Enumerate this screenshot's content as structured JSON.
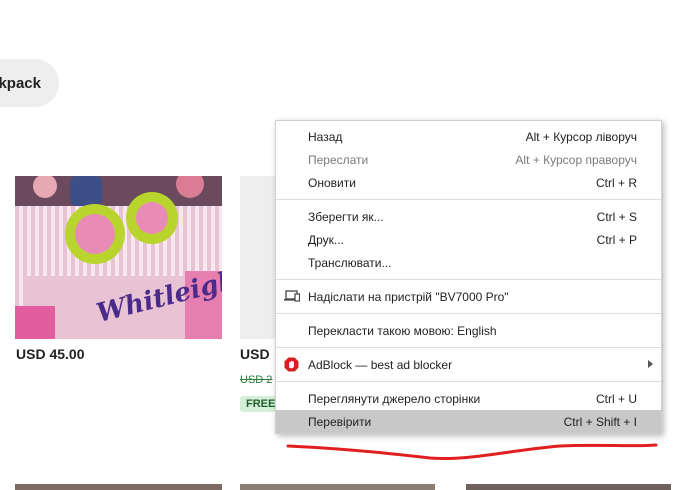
{
  "filter_chip": {
    "label": "kpack"
  },
  "products": [
    {
      "price": "USD 45.00",
      "embroidered_name": "Whitleigh"
    },
    {
      "price": "USD",
      "old_price": "USD 2",
      "badge": "FREE"
    }
  ],
  "context_menu": {
    "groups": [
      [
        {
          "label": "Назад",
          "shortcut": "Alt + Курсор ліворуч",
          "disabled": false
        },
        {
          "label": "Переслати",
          "shortcut": "Alt + Курсор праворуч",
          "disabled": true
        },
        {
          "label": "Оновити",
          "shortcut": "Ctrl + R",
          "disabled": false
        }
      ],
      [
        {
          "label": "Зберегти як...",
          "shortcut": "Ctrl + S"
        },
        {
          "label": "Друк...",
          "shortcut": "Ctrl + P"
        },
        {
          "label": "Транслювати...",
          "shortcut": ""
        }
      ],
      [
        {
          "label": "Надіслати на пристрій \"BV7000 Pro\"",
          "icon": "devices-icon"
        }
      ],
      [
        {
          "label": "Перекласти такою мовою: English"
        }
      ],
      [
        {
          "label": "AdBlock — best ad blocker",
          "icon": "adblock-icon",
          "has_submenu": true
        }
      ],
      [
        {
          "label": "Переглянути джерело сторінки",
          "shortcut": "Ctrl + U"
        },
        {
          "label": "Перевірити",
          "shortcut": "Ctrl + Shift + I",
          "highlighted": true
        }
      ]
    ]
  },
  "colors": {
    "menu_highlight": "#c8c8c8",
    "adblock_red": "#d61f1f",
    "annotation_red": "#e02020",
    "free_badge_bg": "#d4efd8"
  }
}
